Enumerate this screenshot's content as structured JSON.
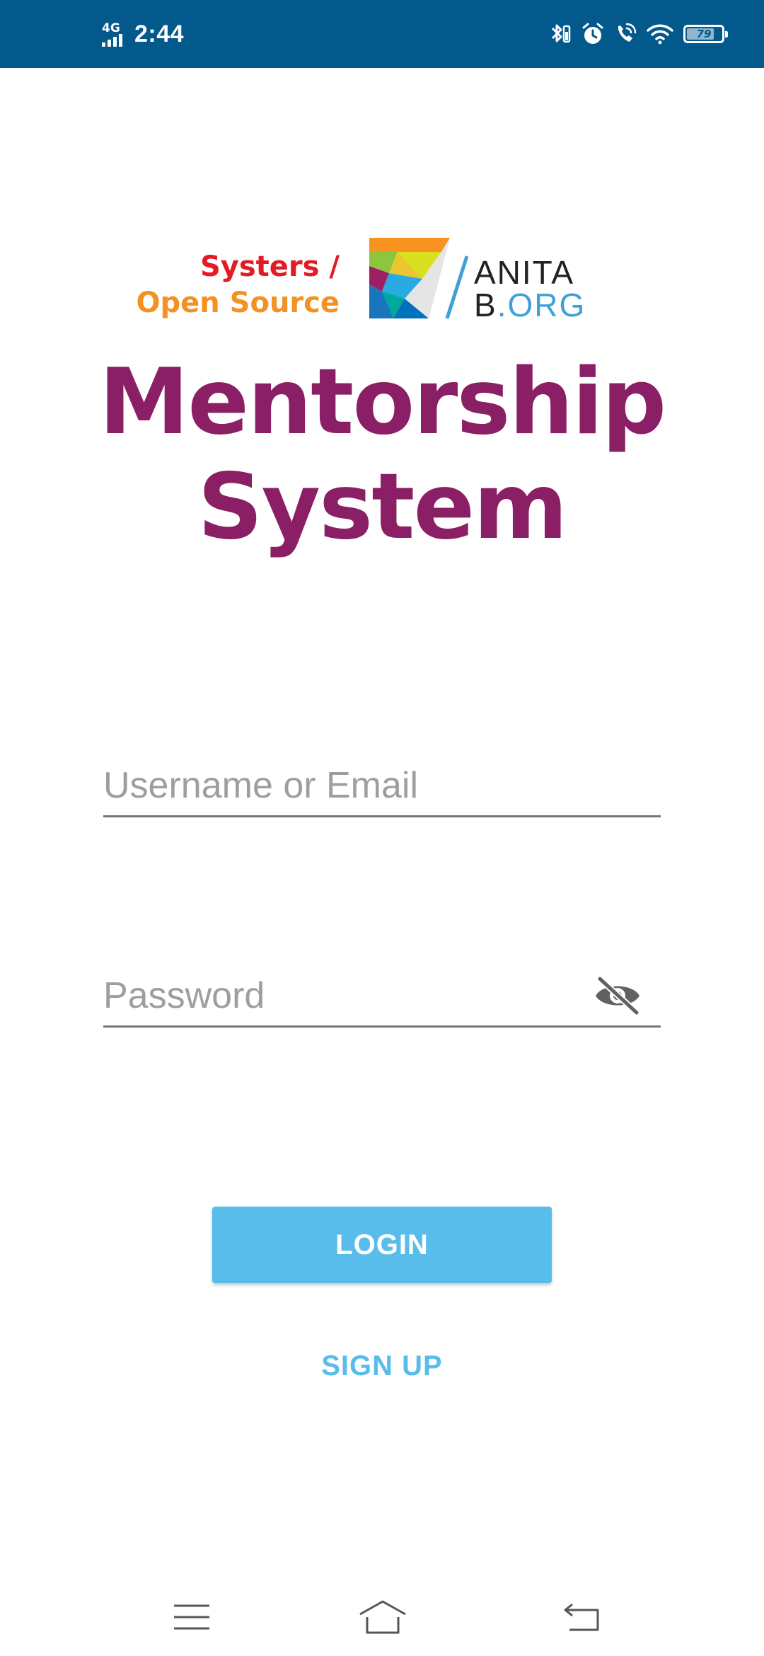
{
  "status_bar": {
    "network": "4G",
    "time": "2:44",
    "battery": "79",
    "battery_level": 0.79,
    "background_color": "#03588c",
    "icons": [
      "bluetooth-battery-icon",
      "alarm-icon",
      "wifi-calling-icon",
      "wifi-icon",
      "battery-icon"
    ]
  },
  "logo": {
    "systers_line1": "Systers /",
    "systers_line2": "Open Source",
    "anita_line1": "ANITA",
    "anita_line2_b": "B",
    "anita_line2_org": ".ORG"
  },
  "title": {
    "line1": "Mentorship",
    "line2": "System",
    "color": "#8b1f65"
  },
  "form": {
    "username": {
      "placeholder": "Username or Email",
      "value": ""
    },
    "password": {
      "placeholder": "Password",
      "value": "",
      "toggle_icon": "eye-off-icon"
    }
  },
  "buttons": {
    "login": "LOGIN",
    "signup": "SIGN UP",
    "accent_color": "#58bdeb"
  },
  "nav": {
    "icons": [
      "menu-icon",
      "home-icon",
      "back-icon"
    ]
  }
}
